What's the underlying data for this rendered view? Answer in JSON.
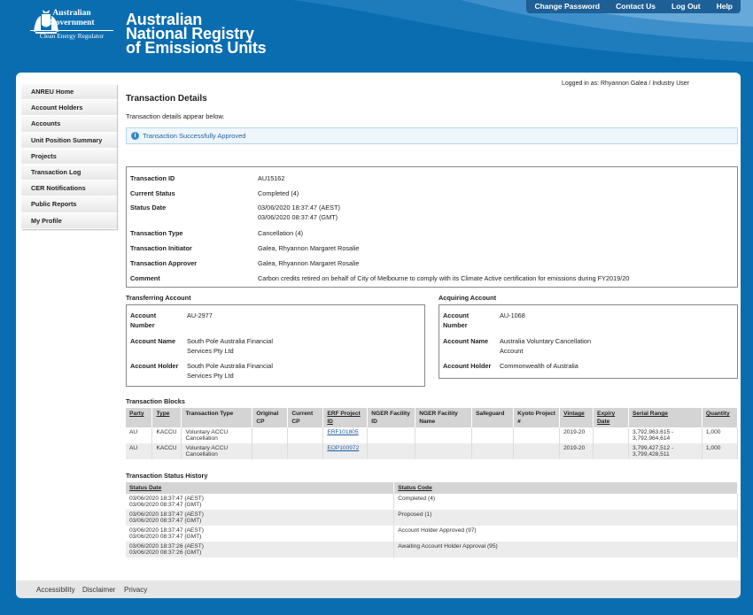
{
  "header": {
    "gov_label": "Australian Government",
    "agency_label": "Clean Energy Regulator",
    "title_line1": "Australian",
    "title_line2": "National Registry",
    "title_line3": "of Emissions Units",
    "nav": [
      "Change Password",
      "Contact Us",
      "Log Out",
      "Help"
    ]
  },
  "login_text": "Logged in as:  Rhyannon Galea / Industry User",
  "sidebar": [
    "ANREU Home",
    "Account Holders",
    "Accounts",
    "Unit Position Summary",
    "Projects",
    "Transaction Log",
    "CER Notifications",
    "Public Reports",
    "My Profile"
  ],
  "page": {
    "title": "Transaction Details",
    "intro": "Transaction details appear below.",
    "alert": "Transaction Successfully Approved"
  },
  "details": {
    "id_label": "Transaction ID",
    "id": "AU15162",
    "status_label": "Current Status",
    "status": "Completed (4)",
    "date_label": "Status Date",
    "date1": "03/06/2020 18:37:47 (AEST)",
    "date2": "03/06/2020 08:37:47 (GMT)",
    "type_label": "Transaction Type",
    "type": "Cancellation (4)",
    "initiator_label": "Transaction Initiator",
    "initiator": "Galea, Rhyannon Margaret Rosalie",
    "approver_label": "Transaction Approver",
    "approver": "Galea, Rhyannon Margaret Rosalie",
    "comment_label": "Comment",
    "comment": "Carbon credits retired on behalf of City of Melbourne to comply with its Climate Active certification for emissions during FY2019/20"
  },
  "transferring": {
    "heading": "Transferring Account",
    "num_label1": "Account",
    "num_label2": "Number",
    "num": "AU-2977",
    "name_label": "Account Name",
    "name1": "South Pole Australia Financial",
    "name2": "Services Pty Ltd",
    "holder_label": "Account Holder",
    "holder1": "South Pole Australia Financial",
    "holder2": "Services Pty Ltd"
  },
  "acquiring": {
    "heading": "Acquiring Account",
    "num_label1": "Account",
    "num_label2": "Number",
    "num": "AU-1068",
    "name_label": "Account Name",
    "name1": "Australia Voluntary Cancellation",
    "name2": "Account",
    "holder_label": "Account Holder",
    "holder1": "Commonwealth of Australia"
  },
  "blocks": {
    "heading": "Transaction Blocks",
    "columns": [
      "Party",
      "Type",
      "Transaction Type",
      "Original CP",
      "Current CP",
      "ERF Project ID",
      "NGER Facility ID",
      "NGER Facility Name",
      "Safeguard",
      "Kyoto Project #",
      "Vintage",
      "Expiry Date",
      "Serial Range",
      "Quantity"
    ],
    "rows": [
      {
        "party": "AU",
        "type": "KACCU",
        "ttype1": "Voluntary ACCU",
        "ttype2": "Cancellation",
        "erf": "ERF101805",
        "vintage": "2019-20",
        "serial1": "3,792,963,615 -",
        "serial2": "3,792,964,614",
        "qty": "1,000"
      },
      {
        "party": "AU",
        "type": "KACCU",
        "ttype1": "Voluntary ACCU",
        "ttype2": "Cancellation",
        "erf": "EOP100972",
        "vintage": "2019-20",
        "serial1": "3,799,427,512 -",
        "serial2": "3,799,428,511",
        "qty": "1,000"
      }
    ]
  },
  "history": {
    "heading": "Transaction Status History",
    "col_date": "Status Date",
    "col_code": "Status Code",
    "rows": [
      {
        "d1": "03/06/2020 18:37:47 (AEST)",
        "d2": "03/06/2020 08:37:47 (GMT)",
        "code": "Completed (4)"
      },
      {
        "d1": "03/06/2020 18:37:47 (AEST)",
        "d2": "03/06/2020 08:37:47 (GMT)",
        "code": "Proposed (1)"
      },
      {
        "d1": "03/06/2020 18:37:47 (AEST)",
        "d2": "03/06/2020 08:37:47 (GMT)",
        "code": "Account Holder Approved (97)"
      },
      {
        "d1": "03/06/2020 18:37:26 (AEST)",
        "d2": "03/06/2020 08:37:26 (GMT)",
        "code": "Awaiting Account Holder Approval (95)"
      }
    ]
  },
  "footer": [
    "Accessibility",
    "Disclaimer",
    "Privacy"
  ]
}
